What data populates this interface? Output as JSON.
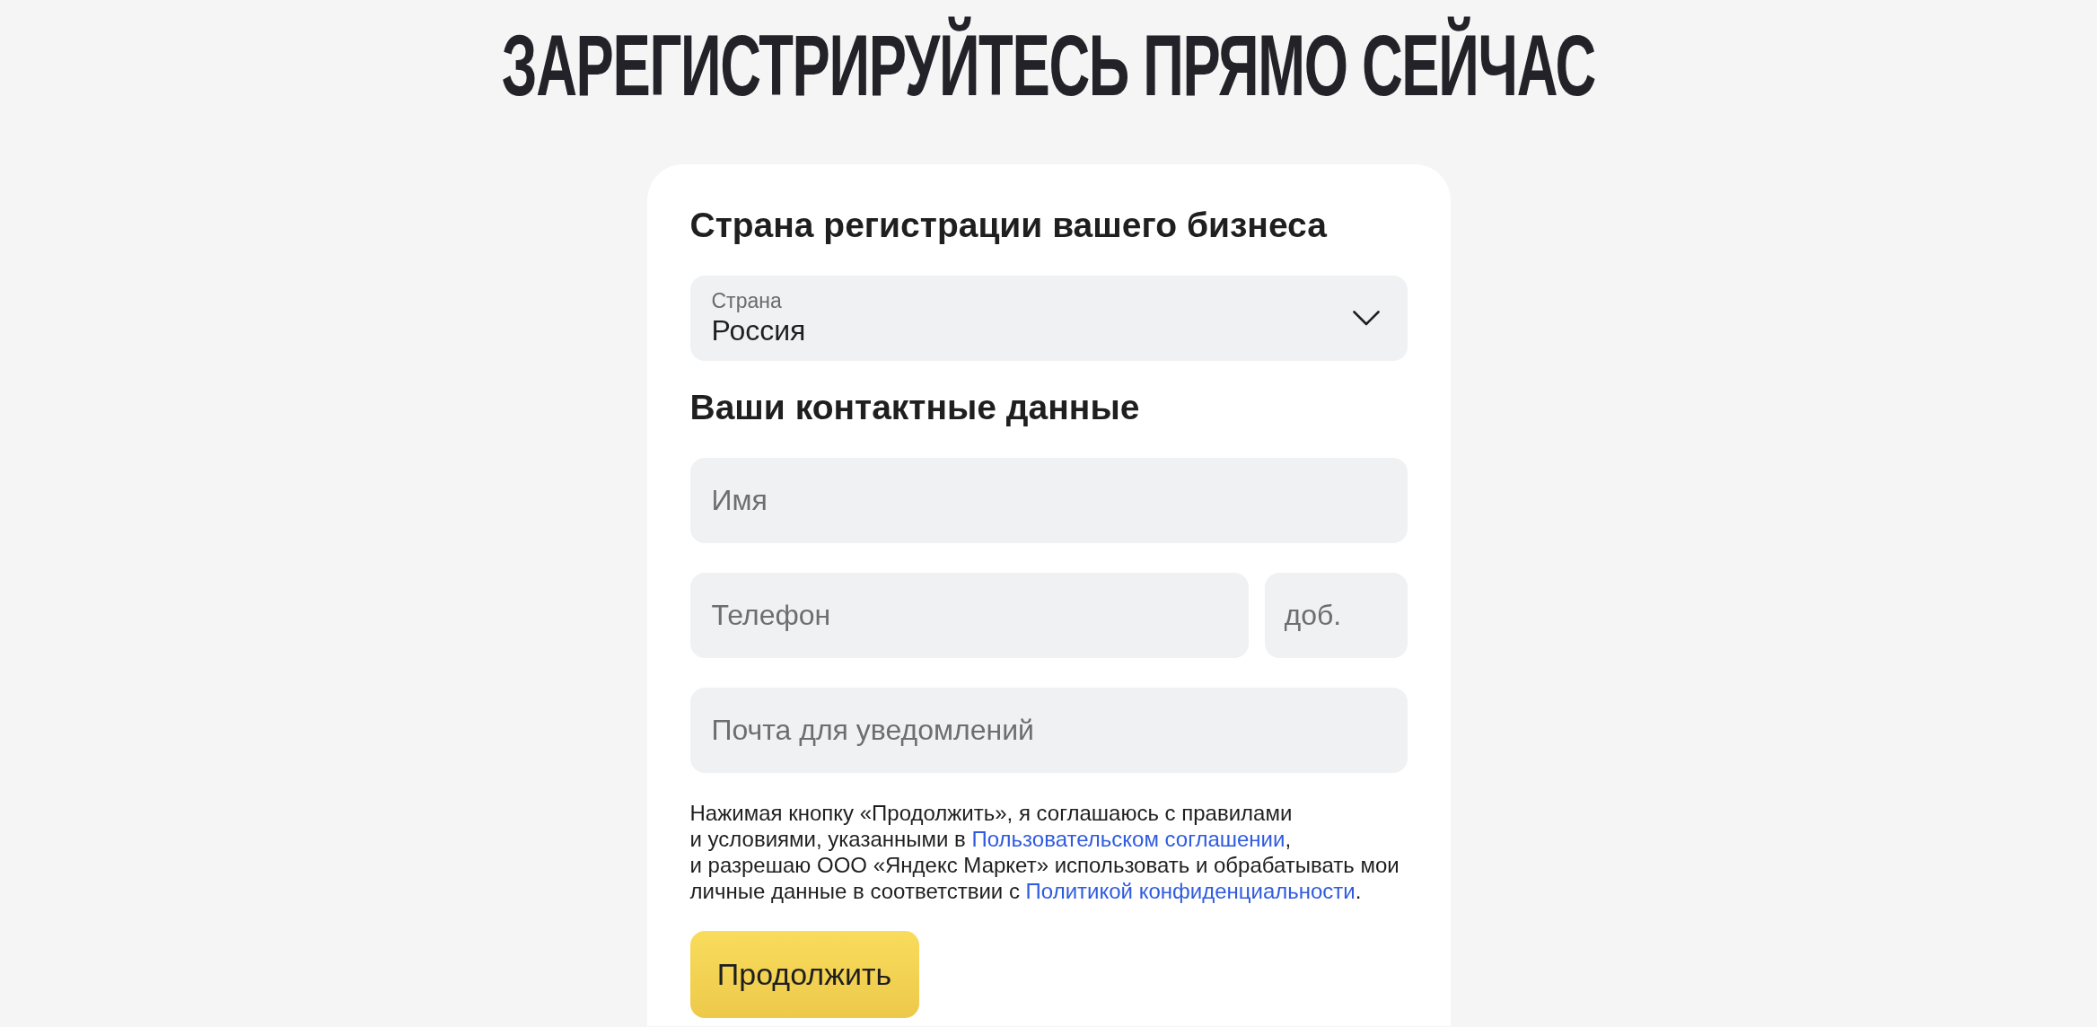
{
  "title": "ЗАРЕГИСТРИРУЙТЕСЬ ПРЯМО СЕЙЧАС",
  "country_section": {
    "heading": "Страна регистрации вашего бизнеса",
    "select": {
      "label": "Страна",
      "value": "Россия"
    }
  },
  "contacts_section": {
    "heading": "Ваши контактные данные",
    "rows": [
      {
        "fields": [
          {
            "kind": "name",
            "placeholder": "Имя"
          }
        ]
      },
      {
        "fields": [
          {
            "kind": "phone",
            "placeholder": "Телефон"
          },
          {
            "kind": "extension",
            "placeholder": "доб."
          }
        ]
      },
      {
        "fields": [
          {
            "kind": "email",
            "placeholder": "Почта для уведомлений"
          }
        ]
      }
    ]
  },
  "consent": {
    "lines": [
      {
        "segments": [
          {
            "kind": "text",
            "text": "Нажимая кнопку «Продолжить», я соглашаюсь с правилами"
          }
        ]
      },
      {
        "segments": [
          {
            "kind": "text",
            "text": "и условиями, указанными в "
          },
          {
            "kind": "link",
            "text": "Пользовательском соглашении"
          },
          {
            "kind": "text",
            "text": ","
          }
        ]
      },
      {
        "segments": [
          {
            "kind": "text",
            "text": "и разрешаю ООО «Яндекс Маркет» использовать и обрабатывать мои"
          }
        ]
      },
      {
        "segments": [
          {
            "kind": "text",
            "text": "личные данные в соответствии с "
          },
          {
            "kind": "link",
            "text": "Политикой конфиденциальности"
          },
          {
            "kind": "text",
            "text": "."
          }
        ]
      }
    ]
  },
  "continue_button": {
    "label": "Продолжить"
  }
}
